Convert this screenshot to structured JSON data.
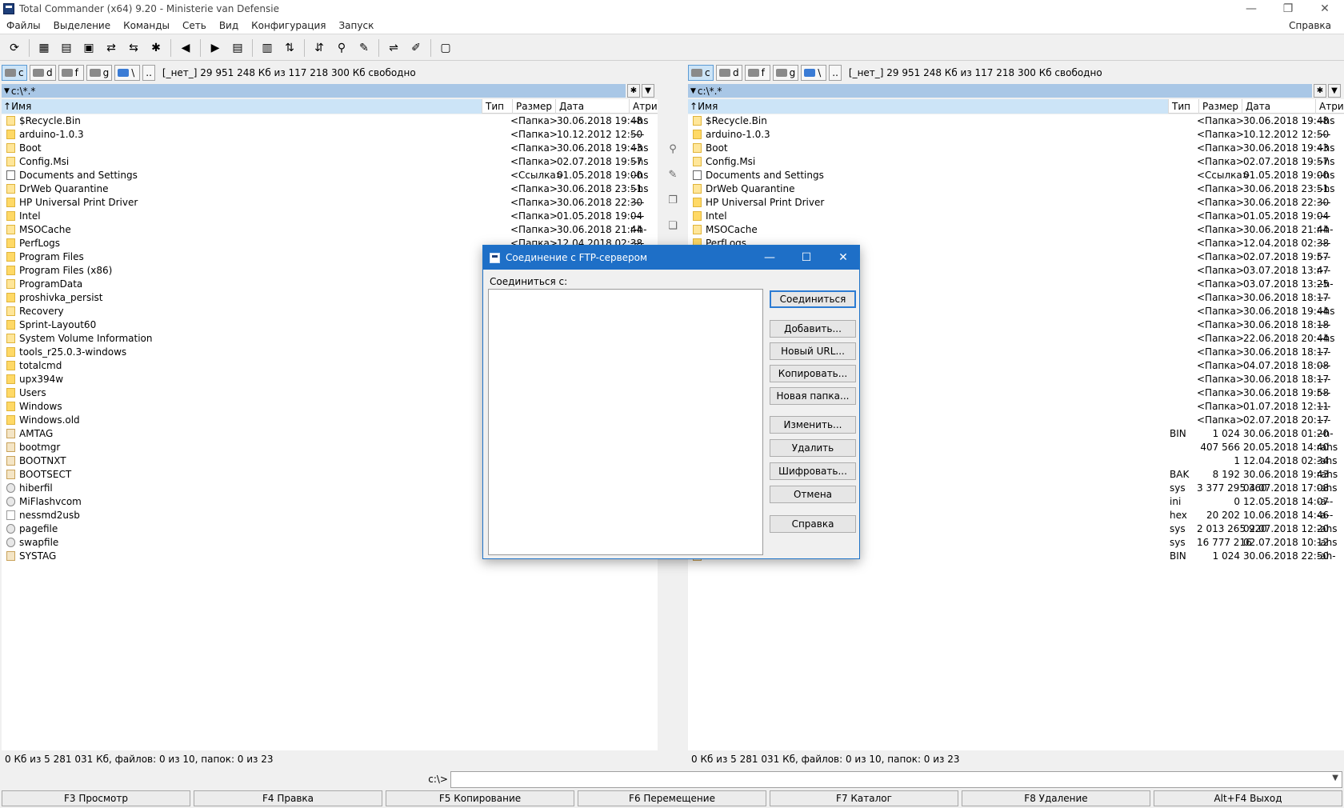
{
  "window": {
    "title": "Total Commander (x64) 9.20 - Ministerie van Defensie",
    "controls": [
      "—",
      "❐",
      "✕"
    ]
  },
  "menu": {
    "items": [
      "Файлы",
      "Выделение",
      "Команды",
      "Сеть",
      "Вид",
      "Конфигурация",
      "Запуск"
    ],
    "help": "Справка"
  },
  "toolbar": {
    "buttons": [
      "refresh-icon",
      "brief-view-icon",
      "tree-view-icon",
      "thumbnails-icon",
      "compare-icon",
      "invert-icon",
      "star-icon",
      "back-icon",
      "forward-icon",
      "pack-icon",
      "unpack-icon",
      "ftp-icon",
      "url-icon",
      "search-icon",
      "rename-icon",
      "sync-icon",
      "notepad-icon",
      "disk-icon"
    ],
    "glyphs": [
      "⟳",
      "▦",
      "▤",
      "▣",
      "⇄",
      "⇆",
      "✱",
      "◀",
      "▶",
      "▤",
      "▥",
      "⇅",
      "⇵",
      "⚲",
      "✎",
      "⇌",
      "✐",
      "▢"
    ]
  },
  "drives": {
    "items": [
      "c",
      "d",
      "f",
      "g",
      "\\"
    ],
    "net_label": "[_нет_]",
    "free_info": "29 951 248 Кб из 117 218 300 Кб свободно",
    "extra": ".."
  },
  "left_panel": {
    "path": "c:\\*.*",
    "columns": {
      "name": "Имя",
      "type": "Тип",
      "size": "Размер",
      "date": "Дата",
      "attr": "Атриб"
    },
    "status": "0 Кб из 5 281 031 Кб, файлов: 0 из 10, папок: 0 из 23"
  },
  "right_panel": {
    "path": "c:\\*.*",
    "columns": {
      "name": "Имя",
      "type": "Тип",
      "size": "Размер",
      "date": "Дата",
      "attr": "Атриб"
    },
    "status": "0 Кб из 5 281 031 Кб, файлов: 0 из 10, папок: 0 из 23"
  },
  "files": [
    {
      "name": "$Recycle.Bin",
      "type": "",
      "size": "<Папка>",
      "date": "30.06.2018 19:48",
      "attr": "--hs",
      "icon": "sysfolder"
    },
    {
      "name": "arduino-1.0.3",
      "type": "",
      "size": "<Папка>",
      "date": "10.12.2012 12:50",
      "attr": "----",
      "icon": "folder"
    },
    {
      "name": "Boot",
      "type": "",
      "size": "<Папка>",
      "date": "30.06.2018 19:43",
      "attr": "--hs",
      "icon": "sysfolder"
    },
    {
      "name": "Config.Msi",
      "type": "",
      "size": "<Папка>",
      "date": "02.07.2018 19:57",
      "attr": "--hs",
      "icon": "sysfolder"
    },
    {
      "name": "Documents and Settings",
      "type": "",
      "size": "<Ссылка>",
      "date": "01.05.2018 19:00",
      "attr": "--hs",
      "icon": "link"
    },
    {
      "name": "DrWeb Quarantine",
      "type": "",
      "size": "<Папка>",
      "date": "30.06.2018 23:51",
      "attr": "--hs",
      "icon": "sysfolder"
    },
    {
      "name": "HP Universal Print Driver",
      "type": "",
      "size": "<Папка>",
      "date": "30.06.2018 22:30",
      "attr": "----",
      "icon": "folder"
    },
    {
      "name": "Intel",
      "type": "",
      "size": "<Папка>",
      "date": "01.05.2018 19:04",
      "attr": "----",
      "icon": "folder"
    },
    {
      "name": "MSOCache",
      "type": "",
      "size": "<Папка>",
      "date": "30.06.2018 21:44",
      "attr": "r-h-",
      "icon": "sysfolder"
    },
    {
      "name": "PerfLogs",
      "type": "",
      "size": "<Папка>",
      "date": "12.04.2018 02:38",
      "attr": "----",
      "icon": "folder"
    },
    {
      "name": "Program Files",
      "type": "",
      "size": "<Папка>",
      "date": "02.07.2018 19:57",
      "attr": "r---",
      "icon": "folder"
    },
    {
      "name": "Program Files (x86)",
      "type": "",
      "size": "<Папка>",
      "date": "03.07.2018 13:47",
      "attr": "r---",
      "icon": "folder"
    },
    {
      "name": "ProgramData",
      "type": "",
      "size": "<Папка>",
      "date": "03.07.2018 13:25",
      "attr": "--h-",
      "icon": "sysfolder"
    },
    {
      "name": "proshivka_persist",
      "type": "",
      "size": "<Папка>",
      "date": "30.06.2018 18:17",
      "attr": "----",
      "icon": "folder"
    },
    {
      "name": "Recovery",
      "type": "",
      "size": "<Папка>",
      "date": "30.06.2018 19:44",
      "attr": "--hs",
      "icon": "sysfolder"
    },
    {
      "name": "Sprint-Layout60",
      "type": "",
      "size": "<Папка>",
      "date": "30.06.2018 18:18",
      "attr": "----",
      "icon": "folder"
    },
    {
      "name": "System Volume Information",
      "type": "",
      "size": "<Папка>",
      "date": "22.06.2018 20:44",
      "attr": "--hs",
      "icon": "sysfolder"
    },
    {
      "name": "tools_r25.0.3-windows",
      "type": "",
      "size": "<Папка>",
      "date": "30.06.2018 18:17",
      "attr": "----",
      "icon": "folder"
    },
    {
      "name": "totalcmd",
      "type": "",
      "size": "<Папка>",
      "date": "04.07.2018 18:08",
      "attr": "----",
      "icon": "folder"
    },
    {
      "name": "upx394w",
      "type": "",
      "size": "<Папка>",
      "date": "30.06.2018 18:17",
      "attr": "----",
      "icon": "folder"
    },
    {
      "name": "Users",
      "type": "",
      "size": "<Папка>",
      "date": "30.06.2018 19:58",
      "attr": "r---",
      "icon": "folder"
    },
    {
      "name": "Windows",
      "type": "",
      "size": "<Папка>",
      "date": "01.07.2018 12:11",
      "attr": "----",
      "icon": "folder"
    },
    {
      "name": "Windows.old",
      "type": "",
      "size": "<Папка>",
      "date": "02.07.2018 20:17",
      "attr": "----",
      "icon": "folder"
    },
    {
      "name": "AMTAG",
      "type": "BIN",
      "size": "1 024",
      "date": "30.06.2018 01:20",
      "attr": "--h-",
      "icon": "sysfile"
    },
    {
      "name": "bootmgr",
      "type": "",
      "size": "407 566",
      "date": "20.05.2018 14:40",
      "attr": "rahs",
      "icon": "sysfile"
    },
    {
      "name": "BOOTNXT",
      "type": "",
      "size": "1",
      "date": "12.04.2018 02:34",
      "attr": "-ahs",
      "icon": "sysfile"
    },
    {
      "name": "BOOTSECT",
      "type": "BAK",
      "size": "8 192",
      "date": "30.06.2018 19:43",
      "attr": "rahs",
      "icon": "sysfile"
    },
    {
      "name": "hiberfil",
      "type": "sys",
      "size": "3 377 295 360",
      "date": "04.07.2018 17:08",
      "attr": "-ahs",
      "icon": "gear"
    },
    {
      "name": "MiFlashvcom",
      "type": "ini",
      "size": "0",
      "date": "12.05.2018 14:07",
      "attr": "-a--",
      "icon": "gear"
    },
    {
      "name": "nessmd2usb",
      "type": "hex",
      "size": "20 202",
      "date": "10.06.2018 14:46",
      "attr": "-a--",
      "icon": "file"
    },
    {
      "name": "pagefile",
      "type": "sys",
      "size": "2 013 265 920",
      "date": "02.07.2018 12:20",
      "attr": "-ahs",
      "icon": "gear"
    },
    {
      "name": "swapfile",
      "type": "sys",
      "size": "16 777 216",
      "date": "02.07.2018 10:12",
      "attr": "-ahs",
      "icon": "gear"
    },
    {
      "name": "SYSTAG",
      "type": "BIN",
      "size": "1 024",
      "date": "30.06.2018 22:50",
      "attr": "-ah-",
      "icon": "sysfile"
    }
  ],
  "command_line": {
    "prompt": "c:\\>"
  },
  "fkeys": [
    "F3 Просмотр",
    "F4 Правка",
    "F5 Копирование",
    "F6 Перемещение",
    "F7 Каталог",
    "F8 Удаление",
    "Alt+F4 Выход"
  ],
  "ftp_dialog": {
    "title": "Соединение с FTP-сервером",
    "connect_to_label": "Соединиться с:",
    "buttons": {
      "connect": "Соединиться",
      "add": "Добавить...",
      "new_url": "Новый URL...",
      "copy": "Копировать...",
      "new_folder": "Новая папка...",
      "edit": "Изменить...",
      "delete": "Удалить",
      "encrypt": "Шифровать...",
      "cancel": "Отмена",
      "help": "Справка"
    }
  }
}
